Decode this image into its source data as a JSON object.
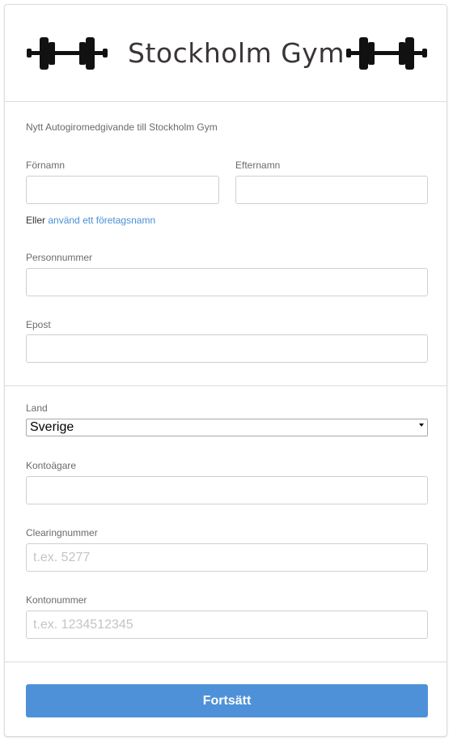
{
  "header": {
    "brand": "Stockholm Gym",
    "logo_icon": "dumbbell-icon"
  },
  "form": {
    "intro": "Nytt Autogiromedgivande till Stockholm Gym",
    "first_name": {
      "label": "Förnamn",
      "value": "",
      "placeholder": ""
    },
    "last_name": {
      "label": "Efternamn",
      "value": "",
      "placeholder": ""
    },
    "company_alt": {
      "prefix": "Eller",
      "link": "använd ett företagsnamn"
    },
    "personal_number": {
      "label": "Personnummer",
      "value": "",
      "placeholder": ""
    },
    "email": {
      "label": "Epost",
      "value": "",
      "placeholder": ""
    },
    "country": {
      "label": "Land",
      "selected": "Sverige"
    },
    "account_holder": {
      "label": "Kontoägare",
      "value": "",
      "placeholder": ""
    },
    "clearing": {
      "label": "Clearingnummer",
      "value": "",
      "placeholder": "t.ex. 5277"
    },
    "account_number": {
      "label": "Kontonummer",
      "value": "",
      "placeholder": "t.ex. 1234512345"
    },
    "submit_label": "Fortsätt"
  },
  "colors": {
    "accent": "#4e91d8",
    "link": "#4a8fd4",
    "brand_text": "#3a3636"
  }
}
